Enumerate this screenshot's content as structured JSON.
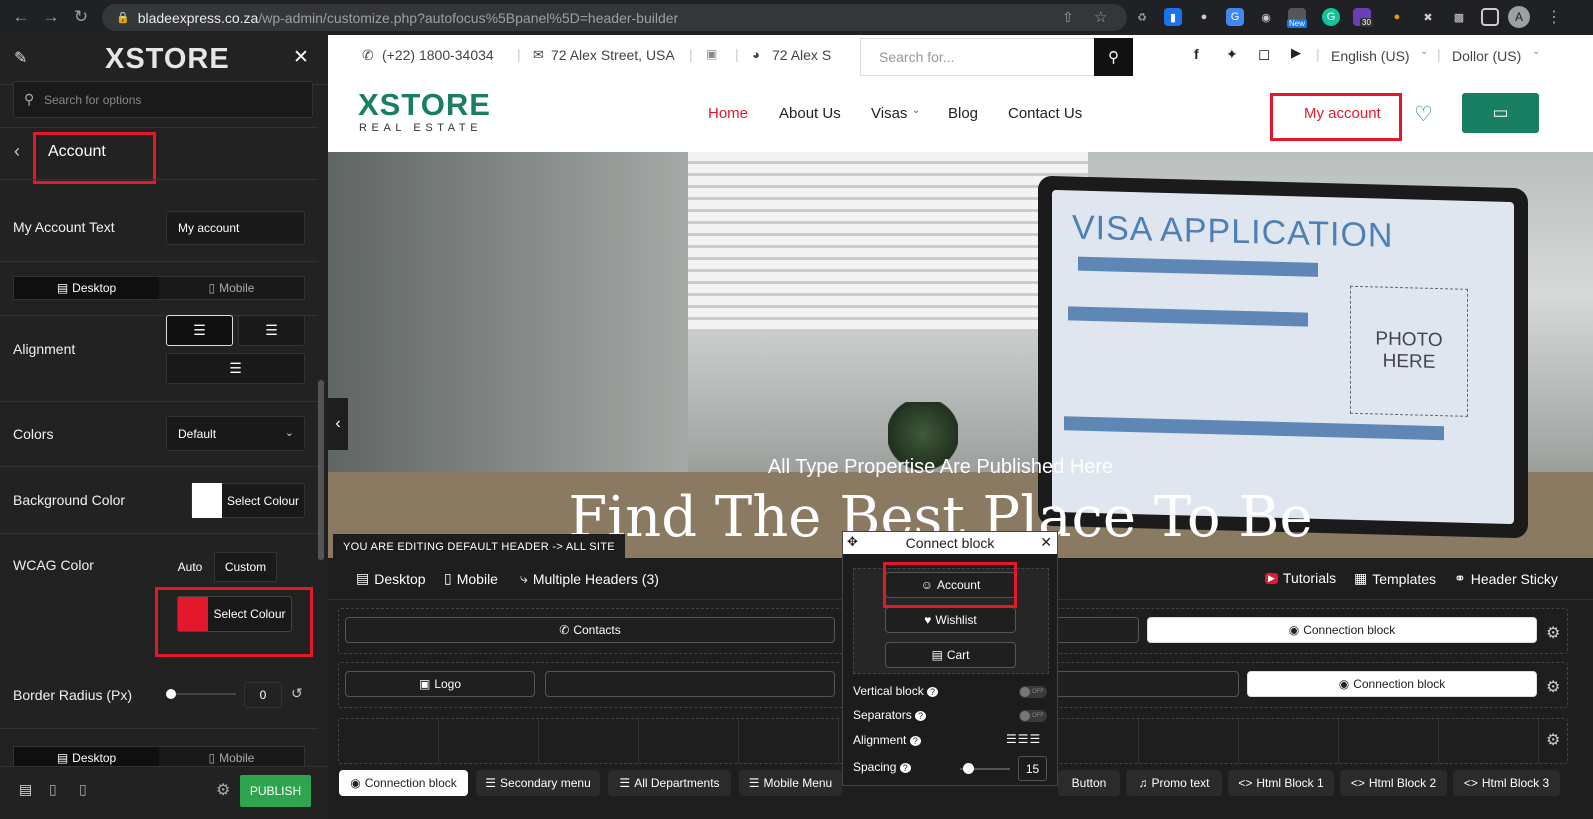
{
  "browser": {
    "url_host": "bladeexpress.co.za",
    "url_path": "/wp-admin/customize.php?autofocus%5Bpanel%5D=header-builder",
    "ext_badge_new": "New",
    "ext_badge_30": "30",
    "avatar_letter": "A"
  },
  "sidebar": {
    "brand": "XSTORE",
    "search_placeholder": "Search for options",
    "section_title": "Account",
    "my_account_text_label": "My Account Text",
    "my_account_text_value": "My account",
    "device_desktop": "Desktop",
    "device_mobile": "Mobile",
    "alignment_label": "Alignment",
    "colors_label": "Colors",
    "colors_value": "Default",
    "bg_color_label": "Background Color",
    "select_colour": "Select Colour",
    "wcag_label": "WCAG Color",
    "wcag_auto": "Auto",
    "wcag_custom": "Custom",
    "wcag_swatch_color": "#e3182d",
    "border_radius_label": "Border Radius (Px)",
    "border_radius_value": "0",
    "publish": "PUBLISH"
  },
  "site": {
    "phone": "(+22) 1800-34034",
    "address": "72 Alex Street, USA",
    "address2": "72 Alex S",
    "search_placeholder": "Search for...",
    "language": "English (US)",
    "currency": "Dollor (US)",
    "logo_main": "XSTORE",
    "logo_sub": "REAL ESTATE",
    "nav": [
      "Home",
      "About Us",
      "Visas",
      "Blog",
      "Contact Us"
    ],
    "my_account": "My account",
    "accent_color": "#197f62",
    "hero_subtitle": "All Type Propertise Are Published Here",
    "hero_title": "Find The Best Place To Be",
    "visa_title": "VISA APPLICATION",
    "photo_here": "PHOTO HERE"
  },
  "builder": {
    "editing_banner": "YOU ARE EDITING DEFAULT HEADER -> ALL SITE",
    "tab_desktop": "Desktop",
    "tab_mobile": "Mobile",
    "tab_multiple": "Multiple Headers (3)",
    "tutorials": "Tutorials",
    "templates": "Templates",
    "header_sticky": "Header Sticky",
    "row1_contacts": "Contacts",
    "row1_connection": "Connection block",
    "row2_logo": "Logo",
    "row2_connection": "Connection block",
    "chips": [
      "Connection block",
      "Secondary menu",
      "All Departments",
      "Mobile Menu",
      "Button",
      "Promo text",
      "Html Block 1",
      "Html Block 2",
      "Html Block 3"
    ]
  },
  "popup": {
    "title": "Connect block",
    "account": "Account",
    "wishlist": "Wishlist",
    "cart": "Cart",
    "vertical_block": "Vertical block",
    "separators": "Separators",
    "alignment": "Alignment",
    "spacing": "Spacing",
    "spacing_value": "15",
    "toggle_off": "OFF"
  }
}
